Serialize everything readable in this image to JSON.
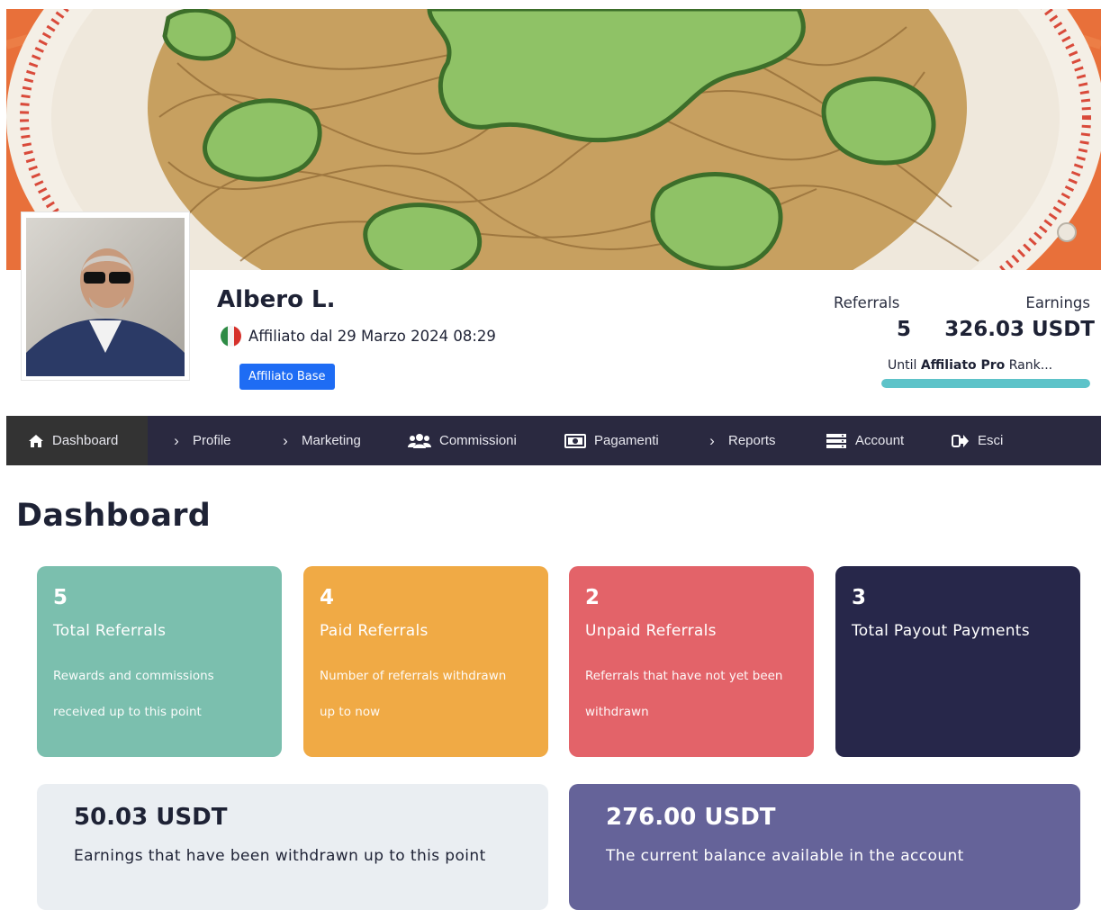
{
  "profile": {
    "name": "Albero L.",
    "joined": "Affiliato dal 29 Marzo 2024 08:29",
    "rank": "Affiliato Base",
    "referrals_label": "Referrals",
    "referrals_value": "5",
    "earnings_label": "Earnings",
    "earnings_value": "326.03 USDT",
    "next_rank_prefix": "Until",
    "next_rank_name": "Affiliato Pro",
    "next_rank_suffix": "Rank...",
    "rank_progress": 1.0
  },
  "nav": [
    {
      "label": "Dashboard",
      "icon": "home-icon",
      "active": true
    },
    {
      "label": "Profile",
      "icon": "chevron-right-icon",
      "active": false
    },
    {
      "label": "Marketing",
      "icon": "chevron-right-icon",
      "active": false
    },
    {
      "label": "Commissioni",
      "icon": "users-icon",
      "active": false
    },
    {
      "label": "Pagamenti",
      "icon": "money-icon",
      "active": false
    },
    {
      "label": "Reports",
      "icon": "chevron-right-icon",
      "active": false
    },
    {
      "label": "Account",
      "icon": "server-icon",
      "active": false
    },
    {
      "label": "Esci",
      "icon": "sign-out-icon",
      "active": false
    }
  ],
  "dashboard": {
    "title": "Dashboard",
    "cards": [
      {
        "value": "5",
        "title": "Total Referrals",
        "line1": "Rewards and commissions",
        "line2": "received up to this point",
        "color": "#7bbfae"
      },
      {
        "value": "4",
        "title": "Paid Referrals",
        "line1": "Number of referrals withdrawn",
        "line2": "up to now",
        "color": "#f0aa45"
      },
      {
        "value": "2",
        "title": "Unpaid Referrals",
        "line1": "Referrals that have not yet been",
        "line2": "withdrawn",
        "color": "#e36369"
      },
      {
        "value": "3",
        "title": "Total Payout Payments",
        "line1": "",
        "line2": "",
        "color": "#27274a"
      }
    ],
    "withdrawn": {
      "amount": "50.03 USDT",
      "label": "Earnings that have been withdrawn up to this point",
      "color": "#eaeef2"
    },
    "balance": {
      "amount": "276.00 USDT",
      "label": "The current balance available in the account",
      "color": "#656399"
    }
  },
  "colors": {
    "nav_bg": "#2a2940",
    "nav_active": "#333333",
    "badge": "#1e6cf4",
    "progress": "#5dc3c9"
  }
}
